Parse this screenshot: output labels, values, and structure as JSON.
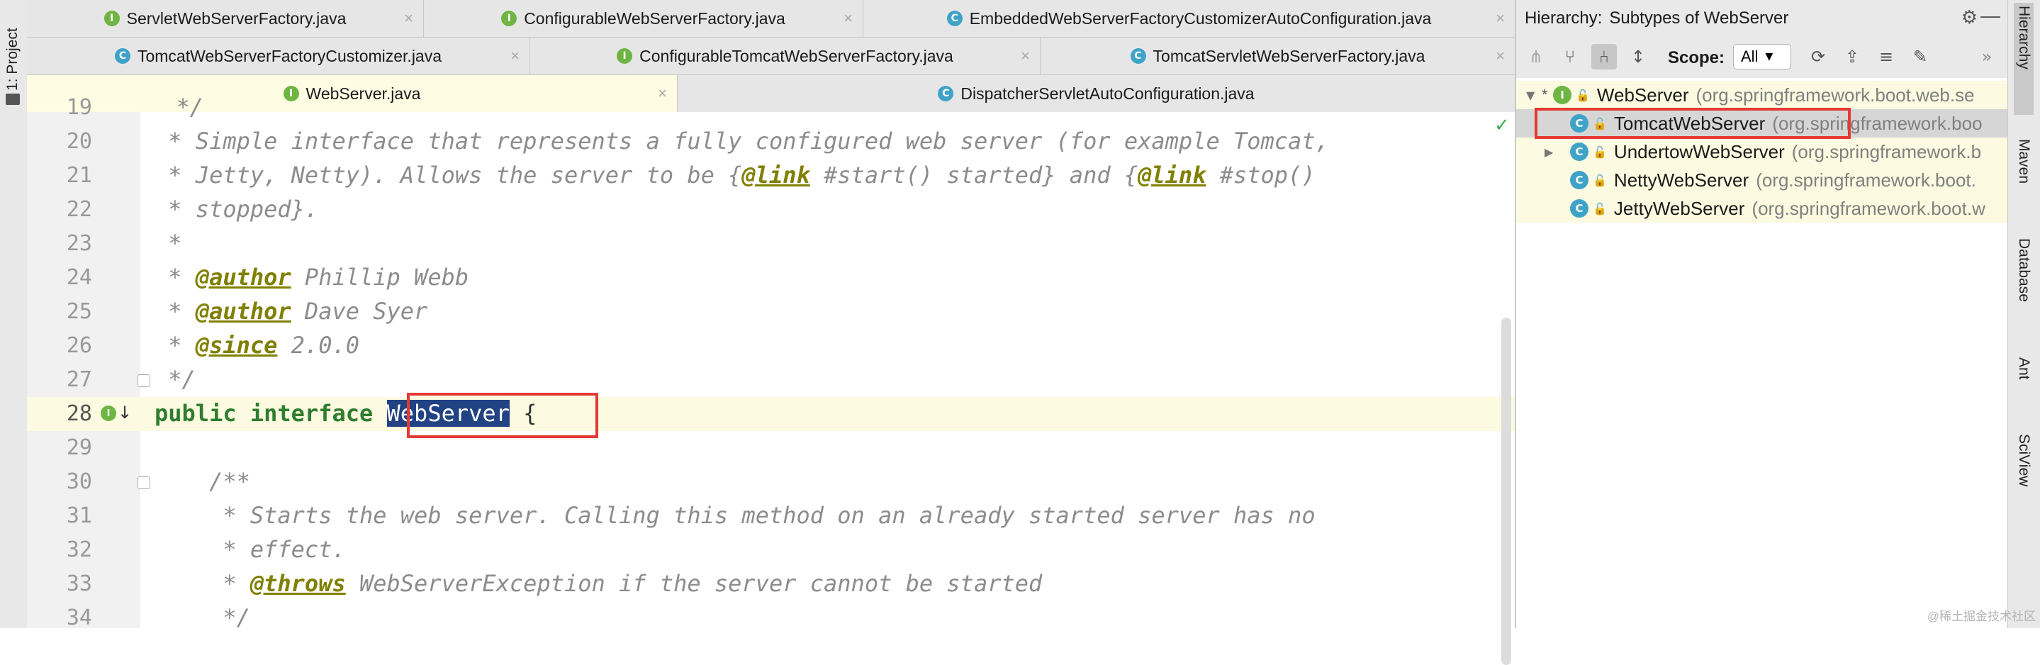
{
  "left_strip": {
    "project_label": "1: Project"
  },
  "tabs": {
    "row1": [
      {
        "label": "ServletWebServerFactory.java",
        "kind": "I"
      },
      {
        "label": "ConfigurableWebServerFactory.java",
        "kind": "I"
      },
      {
        "label": "EmbeddedWebServerFactoryCustomizerAutoConfiguration.java",
        "kind": "C"
      }
    ],
    "row2": [
      {
        "label": "TomcatWebServerFactoryCustomizer.java",
        "kind": "C"
      },
      {
        "label": "ConfigurableTomcatWebServerFactory.java",
        "kind": "I"
      },
      {
        "label": "TomcatServletWebServerFactory.java",
        "kind": "C"
      }
    ],
    "row3": [
      {
        "label": "WebServer.java",
        "kind": "I"
      },
      {
        "label": "DispatcherServletAutoConfiguration.java",
        "kind": "C"
      }
    ],
    "close_glyph": "×"
  },
  "code": {
    "lines": [
      {
        "n": "19",
        "text": "  */"
      },
      {
        "n": "20",
        "text": " * Simple interface that represents a fully configured web server (for example Tomcat,"
      },
      {
        "n": "21",
        "a": " * Jetty, Netty). Allows the server to be {",
        "t1": "@link",
        "b": " #start() started} and {",
        "t2": "@link",
        "c": " #stop()"
      },
      {
        "n": "22",
        "text": " * stopped}."
      },
      {
        "n": "23",
        "text": " *"
      },
      {
        "n": "24",
        "a": " * ",
        "tag": "@author",
        "b": " Phillip Webb"
      },
      {
        "n": "25",
        "a": " * ",
        "tag": "@author",
        "b": " Dave Syer"
      },
      {
        "n": "26",
        "a": " * ",
        "tag": "@since",
        "b": " 2.0.0"
      },
      {
        "n": "27",
        "text": " */"
      },
      {
        "n": "28",
        "kw": "public interface",
        "name": "WebServer",
        "rest": " {"
      },
      {
        "n": "29",
        "text": ""
      },
      {
        "n": "30",
        "text": "    /**"
      },
      {
        "n": "31",
        "text": "     * Starts the web server. Calling this method on an already started server has no"
      },
      {
        "n": "32",
        "text": "     * effect."
      },
      {
        "n": "33",
        "a": "     * ",
        "tag": "@throws",
        "b": " WebServerException if the server cannot be started"
      },
      {
        "n": "34",
        "text": "     */"
      }
    ]
  },
  "hierarchy": {
    "title": "Hierarchy:",
    "subtitle": "Subtypes of WebServer",
    "scope_label": "Scope:",
    "scope_value": "All",
    "items": [
      {
        "name": "WebServer",
        "pkg": "(org.springframework.boot.web.se",
        "kind": "I",
        "expander": "▼",
        "star": "*"
      },
      {
        "name": "TomcatWebServer",
        "pkg": "(org.springframework.boo",
        "kind": "C",
        "expander": "",
        "star": ""
      },
      {
        "name": "UndertowWebServer",
        "pkg": "(org.springframework.b",
        "kind": "C",
        "expander": "▶",
        "star": ""
      },
      {
        "name": "NettyWebServer",
        "pkg": "(org.springframework.boot.",
        "kind": "C",
        "expander": "",
        "star": ""
      },
      {
        "name": "JettyWebServer",
        "pkg": "(org.springframework.boot.w",
        "kind": "C",
        "expander": "",
        "star": ""
      }
    ]
  },
  "right_strip": {
    "tabs": [
      "Hierarchy",
      "Maven",
      "Database",
      "Ant",
      "SciView"
    ]
  },
  "watermark": "@稀土掘金技术社区",
  "colors": {
    "selection": "#214283",
    "highlight_box": "#e53935",
    "current_line": "#fcfae0"
  }
}
